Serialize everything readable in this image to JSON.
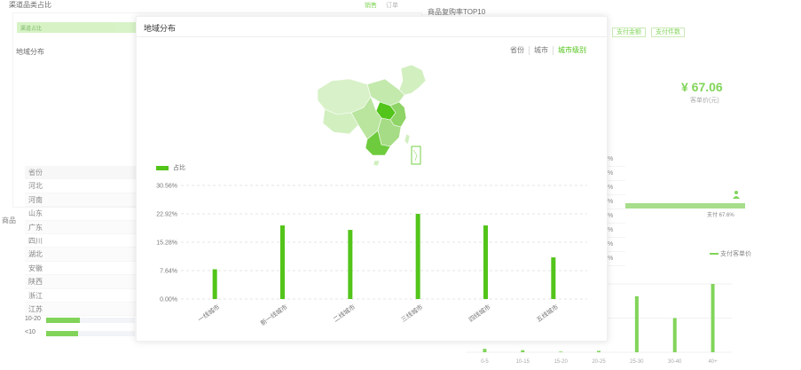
{
  "background_left": {
    "title": "渠道品类占比",
    "tabs": [
      "销售",
      "订单"
    ],
    "active_tab": "销售",
    "strip_label": "渠道占比",
    "subtitle": "地域分布",
    "products_label": "商品",
    "table_header": "省份",
    "table_rows": [
      "河北",
      "河南",
      "山东",
      "广东",
      "四川",
      "湖北",
      "安徽",
      "陕西",
      "浙江",
      "江苏"
    ],
    "progress": [
      {
        "label": "10-20",
        "value": 0.38
      },
      {
        "label": "<10",
        "value": 0.36
      }
    ]
  },
  "background_right": {
    "title": "商品复购率TOP10",
    "tabs": [
      "支付金额",
      "支付件数"
    ],
    "price": "¥ 67.06",
    "price_label": "客单价(元)",
    "stat_rows": [
      "%",
      "%",
      "%",
      "%",
      "%",
      "%",
      "%",
      "%"
    ],
    "bar_label": "支付 67.6%",
    "legend_label": "支付客单价",
    "mini_chart": {
      "categories": [
        "0-5",
        "10-15",
        "15-20",
        "20-25",
        "25-30",
        "30-40",
        "40+"
      ],
      "values": [
        5,
        3,
        1,
        2,
        82,
        50,
        100
      ]
    }
  },
  "card": {
    "title": "地域分布",
    "tabs": [
      "省份",
      "城市",
      "城市级别"
    ],
    "active_tab": 2,
    "legend_label": "占比",
    "colors": {
      "accent": "#52c41a",
      "map_light": "#d2efc0",
      "map_mid": "#a6dc85",
      "map_dark": "#52c41a"
    }
  },
  "chart_data": {
    "type": "bar",
    "categories": [
      "一线城市",
      "新一线城市",
      "二线城市",
      "三线城市",
      "四线城市",
      "五线城市"
    ],
    "series": [
      {
        "name": "占比",
        "values": [
          8.0,
          19.8,
          18.6,
          22.9,
          19.8,
          11.2
        ]
      }
    ],
    "yticks": [
      "0.00%",
      "7.64%",
      "15.28%",
      "22.92%",
      "30.56%"
    ],
    "ylim": [
      0,
      30.56
    ],
    "grid": true,
    "legend": "top-left"
  }
}
